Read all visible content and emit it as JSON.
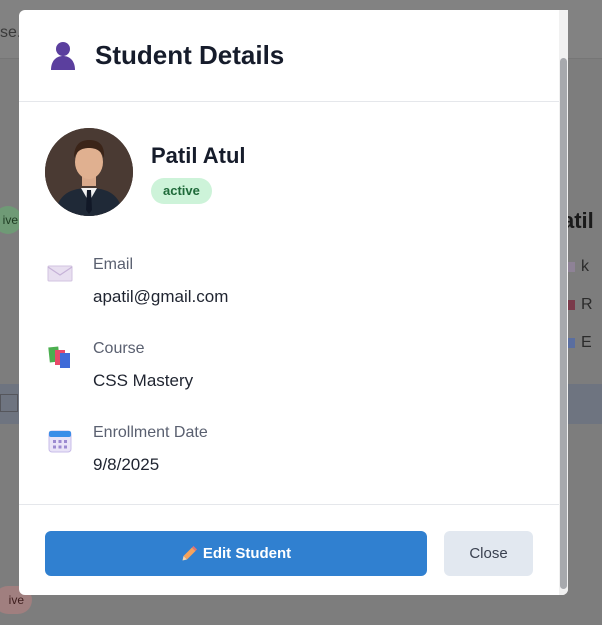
{
  "background": {
    "search_fragment": "se.",
    "left_badge_1": "ive",
    "left_badge_2": "ive",
    "right_name": "atil",
    "right_rows": [
      "k",
      "R",
      "E"
    ]
  },
  "modal": {
    "title": "Student Details",
    "title_icon": "user-icon",
    "student": {
      "name": "Patil Atul",
      "status": "active"
    },
    "fields": [
      {
        "icon": "envelope-icon",
        "label": "Email",
        "value": "apatil@gmail.com"
      },
      {
        "icon": "books-icon",
        "label": "Course",
        "value": "CSS Mastery"
      },
      {
        "icon": "calendar-icon",
        "label": "Enrollment Date",
        "value": "9/8/2025"
      }
    ],
    "buttons": {
      "edit_label": "Edit Student",
      "edit_icon": "pencil-icon",
      "close_label": "Close"
    }
  },
  "colors": {
    "primary": "#3080d0",
    "status_bg": "#cdf3d9",
    "status_text": "#1f6a3a",
    "title_icon": "#5b3f9e"
  }
}
